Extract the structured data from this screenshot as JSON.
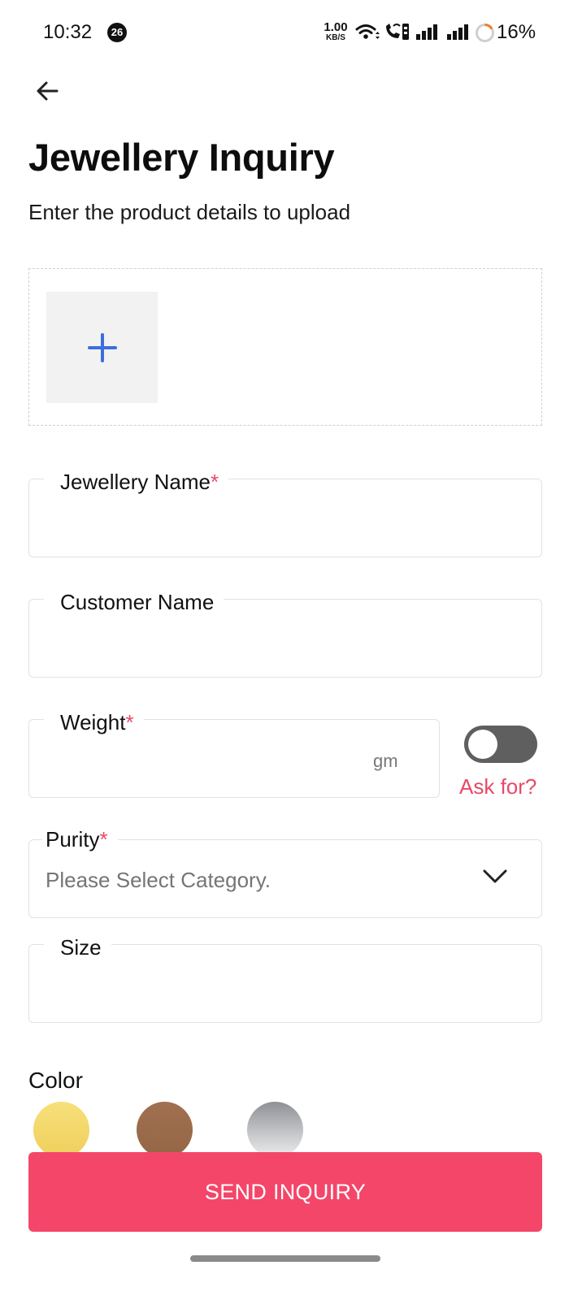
{
  "status_bar": {
    "time": "10:32",
    "notification_count": "26",
    "net_speed_value": "1.00",
    "net_speed_unit": "KB/S",
    "battery_percent": "16%",
    "icons": [
      "wifi-icon",
      "volte-call-icon",
      "signal-icon",
      "signal-icon",
      "battery-ring-icon"
    ]
  },
  "header": {
    "back_icon": "arrow-left-icon",
    "title": "Jewellery Inquiry",
    "subtitle": "Enter the product details to upload"
  },
  "upload": {
    "add_icon": "plus-icon",
    "accent_color": "#3b6fe0"
  },
  "form": {
    "jewellery_name": {
      "label": "Jewellery Name",
      "required_mark": "*",
      "value": ""
    },
    "customer_name": {
      "label": "Customer Name",
      "value": ""
    },
    "weight": {
      "label": "Weight",
      "required_mark": "*",
      "value": "",
      "unit": "gm",
      "ask_for_label": "Ask for?",
      "ask_for_enabled": false
    },
    "purity": {
      "label": "Purity",
      "required_mark": "*",
      "placeholder": "Please Select Category.",
      "icon": "chevron-down-icon"
    },
    "size": {
      "label": "Size",
      "value": ""
    }
  },
  "color": {
    "title": "Color",
    "swatches": [
      {
        "name": "gold",
        "hex": "#f4d96b"
      },
      {
        "name": "rose",
        "hex": "#9b6b4a"
      },
      {
        "name": "silver",
        "hex": "#c6c7ca"
      }
    ]
  },
  "actions": {
    "send_label": "SEND INQUIRY",
    "send_color": "#f44669"
  },
  "colors": {
    "required": "#e8496a",
    "toggle_off": "#5f5f5f"
  }
}
